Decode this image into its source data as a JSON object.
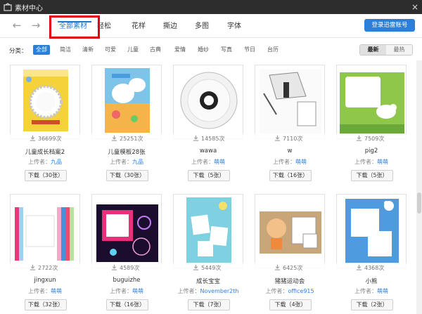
{
  "window": {
    "title": "素材中心",
    "close": "×"
  },
  "nav": {
    "back": "←",
    "forward": "→",
    "tabs": [
      "全部素材",
      "轻松",
      "花样",
      "撕边",
      "多图",
      "字体"
    ],
    "login": "登录迅雷账号"
  },
  "filter": {
    "label": "分类：",
    "chips": [
      "全部",
      "简洁",
      "清新",
      "可爱",
      "儿童",
      "古典",
      "爱情",
      "婚纱",
      "写真",
      "节日",
      "台历"
    ],
    "sort": [
      "最新",
      "最热"
    ]
  },
  "labels": {
    "uploader_prefix": "上传者："
  },
  "items": [
    {
      "count": "36699次",
      "name": "儿童成长档案2",
      "uploader": "九品",
      "download": "下载（30张）"
    },
    {
      "count": "25251次",
      "name": "儿童模板28张",
      "uploader": "九品",
      "download": "下载（30张）"
    },
    {
      "count": "14585次",
      "name": "wawa",
      "uploader": "萌萌",
      "download": "下载（5张）"
    },
    {
      "count": "7110次",
      "name": "w",
      "uploader": "萌萌",
      "download": "下载（16张）"
    },
    {
      "count": "7509次",
      "name": "pig2",
      "uploader": "萌萌",
      "download": "下载（5张）"
    },
    {
      "count": "2722次",
      "name": "jingxun",
      "uploader": "萌萌",
      "download": "下载（32张）"
    },
    {
      "count": "4589次",
      "name": "buguizhe",
      "uploader": "萌萌",
      "download": "下载（16张）"
    },
    {
      "count": "5449次",
      "name": "成长宝宝",
      "uploader": "November2th",
      "download": "下载（7张）"
    },
    {
      "count": "6425次",
      "name": "猪猪运动会",
      "uploader": "office915",
      "download": "下载（4张）"
    },
    {
      "count": "4368次",
      "name": "小熊",
      "uploader": "萌萌",
      "download": "下载（2张）"
    }
  ],
  "colors": {
    "accent": "#2c7fd9",
    "titlebar": "#2d2d2d",
    "highlight": "#e10010"
  }
}
